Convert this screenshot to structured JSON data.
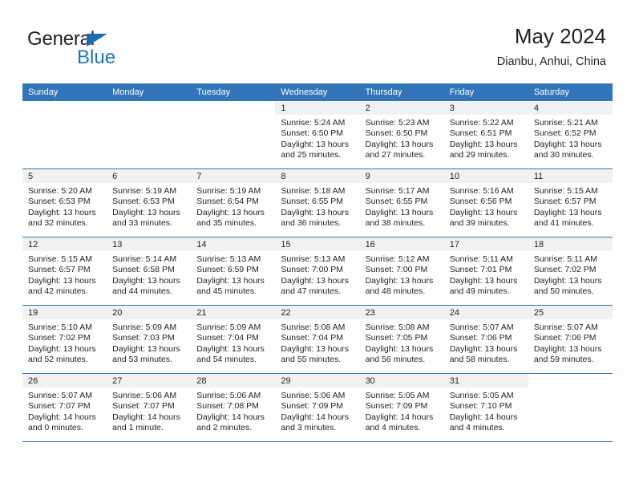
{
  "brand": {
    "name_top": "General",
    "name_bottom": "Blue",
    "color_dark": "#231f20",
    "color_blue": "#1b75bc"
  },
  "header": {
    "title": "May 2024",
    "subtitle": "Dianbu, Anhui, China"
  },
  "theme": {
    "header_bg": "#3275b9",
    "daynum_bg": "#f1f1f1",
    "grid_line": "#3275b9",
    "text": "#231f20"
  },
  "weekday_headers": [
    "Sunday",
    "Monday",
    "Tuesday",
    "Wednesday",
    "Thursday",
    "Friday",
    "Saturday"
  ],
  "weeks": [
    [
      {
        "day": "",
        "blank": true,
        "sunrise": "",
        "sunset": "",
        "daylight1": "",
        "daylight2": ""
      },
      {
        "day": "",
        "blank": true,
        "sunrise": "",
        "sunset": "",
        "daylight1": "",
        "daylight2": ""
      },
      {
        "day": "",
        "blank": true,
        "sunrise": "",
        "sunset": "",
        "daylight1": "",
        "daylight2": ""
      },
      {
        "day": "1",
        "sunrise": "Sunrise: 5:24 AM",
        "sunset": "Sunset: 6:50 PM",
        "daylight1": "Daylight: 13 hours",
        "daylight2": "and 25 minutes."
      },
      {
        "day": "2",
        "sunrise": "Sunrise: 5:23 AM",
        "sunset": "Sunset: 6:50 PM",
        "daylight1": "Daylight: 13 hours",
        "daylight2": "and 27 minutes."
      },
      {
        "day": "3",
        "sunrise": "Sunrise: 5:22 AM",
        "sunset": "Sunset: 6:51 PM",
        "daylight1": "Daylight: 13 hours",
        "daylight2": "and 29 minutes."
      },
      {
        "day": "4",
        "sunrise": "Sunrise: 5:21 AM",
        "sunset": "Sunset: 6:52 PM",
        "daylight1": "Daylight: 13 hours",
        "daylight2": "and 30 minutes."
      }
    ],
    [
      {
        "day": "5",
        "sunrise": "Sunrise: 5:20 AM",
        "sunset": "Sunset: 6:53 PM",
        "daylight1": "Daylight: 13 hours",
        "daylight2": "and 32 minutes."
      },
      {
        "day": "6",
        "sunrise": "Sunrise: 5:19 AM",
        "sunset": "Sunset: 6:53 PM",
        "daylight1": "Daylight: 13 hours",
        "daylight2": "and 33 minutes."
      },
      {
        "day": "7",
        "sunrise": "Sunrise: 5:19 AM",
        "sunset": "Sunset: 6:54 PM",
        "daylight1": "Daylight: 13 hours",
        "daylight2": "and 35 minutes."
      },
      {
        "day": "8",
        "sunrise": "Sunrise: 5:18 AM",
        "sunset": "Sunset: 6:55 PM",
        "daylight1": "Daylight: 13 hours",
        "daylight2": "and 36 minutes."
      },
      {
        "day": "9",
        "sunrise": "Sunrise: 5:17 AM",
        "sunset": "Sunset: 6:55 PM",
        "daylight1": "Daylight: 13 hours",
        "daylight2": "and 38 minutes."
      },
      {
        "day": "10",
        "sunrise": "Sunrise: 5:16 AM",
        "sunset": "Sunset: 6:56 PM",
        "daylight1": "Daylight: 13 hours",
        "daylight2": "and 39 minutes."
      },
      {
        "day": "11",
        "sunrise": "Sunrise: 5:15 AM",
        "sunset": "Sunset: 6:57 PM",
        "daylight1": "Daylight: 13 hours",
        "daylight2": "and 41 minutes."
      }
    ],
    [
      {
        "day": "12",
        "sunrise": "Sunrise: 5:15 AM",
        "sunset": "Sunset: 6:57 PM",
        "daylight1": "Daylight: 13 hours",
        "daylight2": "and 42 minutes."
      },
      {
        "day": "13",
        "sunrise": "Sunrise: 5:14 AM",
        "sunset": "Sunset: 6:58 PM",
        "daylight1": "Daylight: 13 hours",
        "daylight2": "and 44 minutes."
      },
      {
        "day": "14",
        "sunrise": "Sunrise: 5:13 AM",
        "sunset": "Sunset: 6:59 PM",
        "daylight1": "Daylight: 13 hours",
        "daylight2": "and 45 minutes."
      },
      {
        "day": "15",
        "sunrise": "Sunrise: 5:13 AM",
        "sunset": "Sunset: 7:00 PM",
        "daylight1": "Daylight: 13 hours",
        "daylight2": "and 47 minutes."
      },
      {
        "day": "16",
        "sunrise": "Sunrise: 5:12 AM",
        "sunset": "Sunset: 7:00 PM",
        "daylight1": "Daylight: 13 hours",
        "daylight2": "and 48 minutes."
      },
      {
        "day": "17",
        "sunrise": "Sunrise: 5:11 AM",
        "sunset": "Sunset: 7:01 PM",
        "daylight1": "Daylight: 13 hours",
        "daylight2": "and 49 minutes."
      },
      {
        "day": "18",
        "sunrise": "Sunrise: 5:11 AM",
        "sunset": "Sunset: 7:02 PM",
        "daylight1": "Daylight: 13 hours",
        "daylight2": "and 50 minutes."
      }
    ],
    [
      {
        "day": "19",
        "sunrise": "Sunrise: 5:10 AM",
        "sunset": "Sunset: 7:02 PM",
        "daylight1": "Daylight: 13 hours",
        "daylight2": "and 52 minutes."
      },
      {
        "day": "20",
        "sunrise": "Sunrise: 5:09 AM",
        "sunset": "Sunset: 7:03 PM",
        "daylight1": "Daylight: 13 hours",
        "daylight2": "and 53 minutes."
      },
      {
        "day": "21",
        "sunrise": "Sunrise: 5:09 AM",
        "sunset": "Sunset: 7:04 PM",
        "daylight1": "Daylight: 13 hours",
        "daylight2": "and 54 minutes."
      },
      {
        "day": "22",
        "sunrise": "Sunrise: 5:08 AM",
        "sunset": "Sunset: 7:04 PM",
        "daylight1": "Daylight: 13 hours",
        "daylight2": "and 55 minutes."
      },
      {
        "day": "23",
        "sunrise": "Sunrise: 5:08 AM",
        "sunset": "Sunset: 7:05 PM",
        "daylight1": "Daylight: 13 hours",
        "daylight2": "and 56 minutes."
      },
      {
        "day": "24",
        "sunrise": "Sunrise: 5:07 AM",
        "sunset": "Sunset: 7:06 PM",
        "daylight1": "Daylight: 13 hours",
        "daylight2": "and 58 minutes."
      },
      {
        "day": "25",
        "sunrise": "Sunrise: 5:07 AM",
        "sunset": "Sunset: 7:06 PM",
        "daylight1": "Daylight: 13 hours",
        "daylight2": "and 59 minutes."
      }
    ],
    [
      {
        "day": "26",
        "sunrise": "Sunrise: 5:07 AM",
        "sunset": "Sunset: 7:07 PM",
        "daylight1": "Daylight: 14 hours",
        "daylight2": "and 0 minutes."
      },
      {
        "day": "27",
        "sunrise": "Sunrise: 5:06 AM",
        "sunset": "Sunset: 7:07 PM",
        "daylight1": "Daylight: 14 hours",
        "daylight2": "and 1 minute."
      },
      {
        "day": "28",
        "sunrise": "Sunrise: 5:06 AM",
        "sunset": "Sunset: 7:08 PM",
        "daylight1": "Daylight: 14 hours",
        "daylight2": "and 2 minutes."
      },
      {
        "day": "29",
        "sunrise": "Sunrise: 5:06 AM",
        "sunset": "Sunset: 7:09 PM",
        "daylight1": "Daylight: 14 hours",
        "daylight2": "and 3 minutes."
      },
      {
        "day": "30",
        "sunrise": "Sunrise: 5:05 AM",
        "sunset": "Sunset: 7:09 PM",
        "daylight1": "Daylight: 14 hours",
        "daylight2": "and 4 minutes."
      },
      {
        "day": "31",
        "sunrise": "Sunrise: 5:05 AM",
        "sunset": "Sunset: 7:10 PM",
        "daylight1": "Daylight: 14 hours",
        "daylight2": "and 4 minutes."
      },
      {
        "day": "",
        "blank": true,
        "sunrise": "",
        "sunset": "",
        "daylight1": "",
        "daylight2": ""
      }
    ]
  ]
}
